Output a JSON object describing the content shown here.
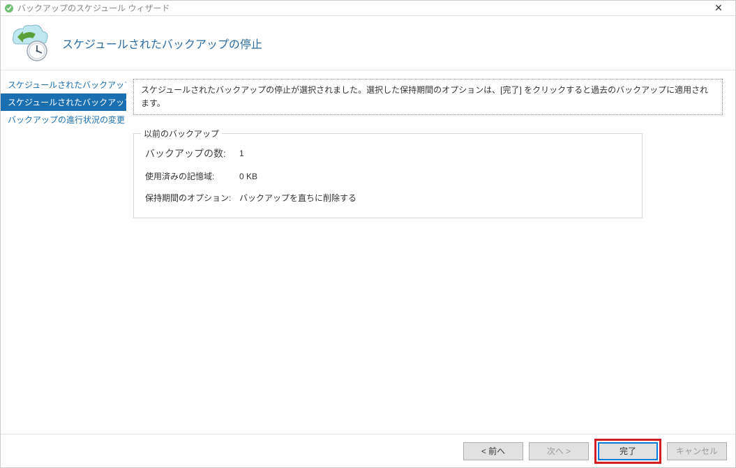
{
  "window": {
    "title": "バックアップのスケジュール ウィザード",
    "close_icon": "✕"
  },
  "header": {
    "title": "スケジュールされたバックアップの停止"
  },
  "sidebar": {
    "items": [
      {
        "label": "スケジュールされたバックアップを変..."
      },
      {
        "label": "スケジュールされたバックアップの停"
      },
      {
        "label": "バックアップの進行状況の変更"
      }
    ],
    "selected_index": 1
  },
  "main": {
    "info_text": "スケジュールされたバックアップの停止が選択されました。選択した保持期間のオプションは、[完了] をクリックすると過去のバックアップに適用されます。",
    "group": {
      "title": "以前のバックアップ",
      "rows": [
        {
          "label": "バックアップの数:",
          "value": "1"
        },
        {
          "label": "使用済みの記憶域:",
          "value": "0 KB"
        },
        {
          "label": "保持期間のオプション:",
          "value": "バックアップを直ちに削除する"
        }
      ]
    }
  },
  "footer": {
    "prev": "< 前へ",
    "next": "次へ >",
    "finish": "完了",
    "cancel": "キャンセル"
  }
}
